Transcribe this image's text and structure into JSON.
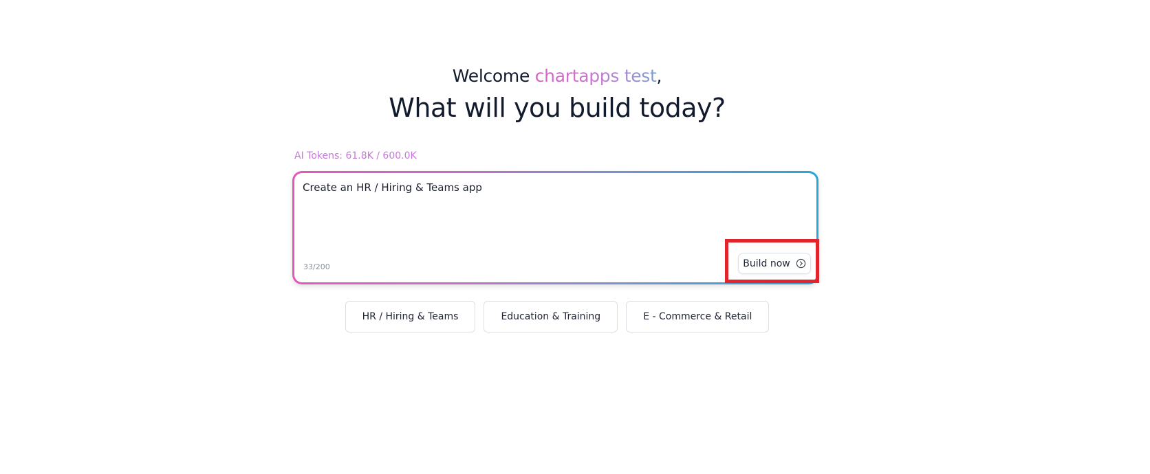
{
  "welcome": {
    "prefix": "Welcome ",
    "user_name": "chartapps test",
    "suffix": ","
  },
  "headline": "What will you build today?",
  "tokens": {
    "label": "AI Tokens: 61.8K / 600.0K"
  },
  "prompt": {
    "value": "Create an HR / Hiring & Teams app",
    "char_count": "33/200",
    "build_label": "Build now"
  },
  "suggestions": [
    {
      "label": "HR / Hiring & Teams"
    },
    {
      "label": "Education & Training"
    },
    {
      "label": "E - Commerce & Retail"
    }
  ],
  "colors": {
    "highlight": "#e3242b",
    "tokens_text": "#c47ad8",
    "gradient_start": "#e05ab8",
    "gradient_end": "#27a8d8"
  },
  "icons": {
    "build_button_icon": "chevron-right-circle-icon"
  }
}
